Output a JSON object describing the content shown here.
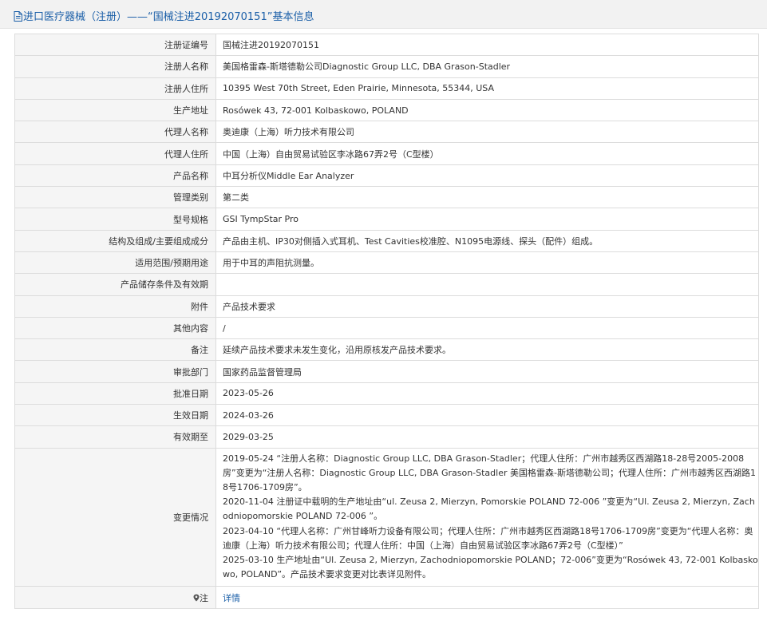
{
  "header": {
    "title": "进口医疗器械（注册）——“国械注进20192070151”基本信息"
  },
  "rows": [
    {
      "label": "注册证编号",
      "value": "国械注进20192070151"
    },
    {
      "label": "注册人名称",
      "value": "美国格雷森-斯塔德勒公司Diagnostic Group LLC, DBA Grason-Stadler"
    },
    {
      "label": "注册人住所",
      "value": "10395 West 70th Street, Eden Prairie, Minnesota, 55344, USA"
    },
    {
      "label": "生产地址",
      "value": "Rosówek 43, 72-001 Kolbaskowo, POLAND"
    },
    {
      "label": "代理人名称",
      "value": "奥迪康（上海）听力技术有限公司"
    },
    {
      "label": "代理人住所",
      "value": "中国（上海）自由贸易试验区李冰路67弄2号（C型楼）"
    },
    {
      "label": "产品名称",
      "value": "中耳分析仪Middle Ear Analyzer"
    },
    {
      "label": "管理类别",
      "value": "第二类"
    },
    {
      "label": "型号规格",
      "value": "GSI TympStar Pro"
    },
    {
      "label": "结构及组成/主要组成成分",
      "value": "产品由主机、IP30对侧插入式耳机、Test Cavities校准腔、N1095电源线、探头（配件）组成。"
    },
    {
      "label": "适用范围/预期用途",
      "value": "用于中耳的声阻抗测量。"
    },
    {
      "label": "产品储存条件及有效期",
      "value": ""
    },
    {
      "label": "附件",
      "value": "产品技术要求"
    },
    {
      "label": "其他内容",
      "value": "/"
    },
    {
      "label": "备注",
      "value": "延续产品技术要求未发生变化，沿用原核发产品技术要求。"
    },
    {
      "label": "审批部门",
      "value": "国家药品监督管理局"
    },
    {
      "label": "批准日期",
      "value": "2023-05-26"
    },
    {
      "label": "生效日期",
      "value": "2024-03-26"
    },
    {
      "label": "有效期至",
      "value": "2029-03-25"
    }
  ],
  "changes": {
    "label": "变更情况",
    "entries": [
      "2019-05-24 “注册人名称：Diagnostic Group LLC, DBA Grason-Stadler；代理人住所：广州市越秀区西湖路18-28号2005-2008房”变更为“注册人名称：Diagnostic Group LLC, DBA Grason-Stadler 美国格雷森-斯塔德勒公司；代理人住所：广州市越秀区西湖路18号1706-1709房”。",
      "2020-11-04 注册证中载明的生产地址由“ul. Zeusa 2, Mierzyn, Pomorskie POLAND 72-006 ”变更为“Ul. Zeusa 2, Mierzyn, Zachodniopomorskie POLAND 72-006 ”。",
      "2023-04-10 “代理人名称：广州甘峰听力设备有限公司；代理人住所：广州市越秀区西湖路18号1706-1709房”变更为“代理人名称：奥迪康（上海）听力技术有限公司；代理人住所：中国（上海）自由贸易试验区李冰路67弄2号（C型楼）”",
      "2025-03-10 生产地址由“Ul. Zeusa 2, Mierzyn, Zachodniopomorskie POLAND；72-006”变更为“Rosówek 43, 72-001 Kolbaskowo, POLAND”。产品技术要求变更对比表详见附件。"
    ]
  },
  "note": {
    "label": "注",
    "link_text": "详情",
    "icon": "map-pin-icon"
  },
  "colors": {
    "accent": "#1b5fa8",
    "label_bg": "#f5f5f5",
    "border": "#dcdcdc",
    "header_bg": "#f2f2f2"
  }
}
